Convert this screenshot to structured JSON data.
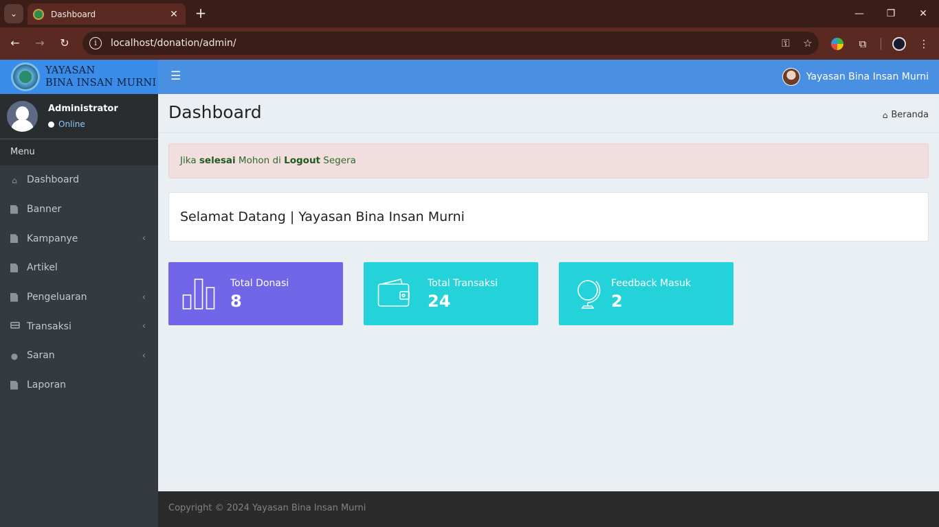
{
  "browser": {
    "tab_title": "Dashboard",
    "url": "localhost/donation/admin/"
  },
  "app": {
    "brand_line1": "YAYASAN",
    "brand_line2": "BINA INSAN MURNI",
    "top_user": "Yayasan Bina Insan Murni"
  },
  "sidebar": {
    "user_name": "Administrator",
    "status": "Online",
    "menu_header": "Menu",
    "items": [
      {
        "label": "Dashboard"
      },
      {
        "label": "Banner"
      },
      {
        "label": "Kampanye"
      },
      {
        "label": "Artikel"
      },
      {
        "label": "Pengeluaran"
      },
      {
        "label": "Transaksi"
      },
      {
        "label": "Saran"
      },
      {
        "label": "Laporan"
      }
    ]
  },
  "content": {
    "title": "Dashboard",
    "breadcrumb": "Beranda",
    "alert": {
      "part1": "Jika ",
      "bold1": "selesai",
      "part2": " Mohon di ",
      "bold2": "Logout",
      "part3": " Segera"
    },
    "welcome": "Selamat Datang | Yayasan Bina Insan Murni",
    "stats": [
      {
        "label": "Total Donasi",
        "value": "8",
        "color": "#7266e8",
        "icon": "bar-chart-icon"
      },
      {
        "label": "Total Transaksi",
        "value": "24",
        "color": "#23d3d9",
        "icon": "wallet-icon"
      },
      {
        "label": "Feedback Masuk",
        "value": "2",
        "color": "#23d3d9",
        "icon": "globe-icon"
      }
    ]
  },
  "footer": {
    "text": "Copyright © 2024 Yayasan Bina Insan Murni"
  }
}
